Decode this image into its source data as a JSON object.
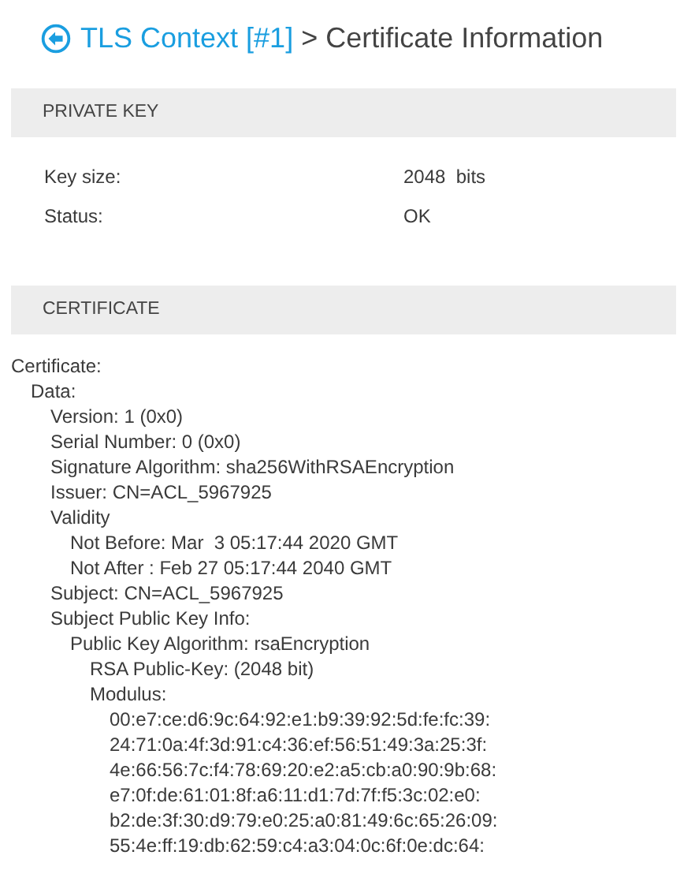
{
  "header": {
    "back_link": "TLS Context [#1]",
    "separator": ">",
    "title": "Certificate Information"
  },
  "private_key": {
    "heading": "PRIVATE KEY",
    "rows": [
      {
        "label": "Key size:",
        "value": "2048  bits"
      },
      {
        "label": "Status:",
        "value": "OK"
      }
    ]
  },
  "certificate": {
    "heading": "CERTIFICATE",
    "tree": [
      {
        "text": "Certificate:",
        "children": [
          {
            "text": "Data:",
            "children": [
              {
                "text": "Version: 1 (0x0)"
              },
              {
                "text": "Serial Number: 0 (0x0)"
              },
              {
                "text": "Signature Algorithm: sha256WithRSAEncryption"
              },
              {
                "text": "Issuer: CN=ACL_5967925"
              },
              {
                "text": "Validity",
                "children": [
                  {
                    "text": "Not Before: Mar  3 05:17:44 2020 GMT"
                  },
                  {
                    "text": "Not After : Feb 27 05:17:44 2040 GMT"
                  }
                ]
              },
              {
                "text": "Subject: CN=ACL_5967925"
              },
              {
                "text": "Subject Public Key Info:",
                "children": [
                  {
                    "text": "Public Key Algorithm: rsaEncryption",
                    "children": [
                      {
                        "text": "RSA Public-Key: (2048 bit)"
                      },
                      {
                        "text": "Modulus:",
                        "children": [
                          {
                            "text": "00:e7:ce:d6:9c:64:92:e1:b9:39:92:5d:fe:fc:39:"
                          },
                          {
                            "text": "24:71:0a:4f:3d:91:c4:36:ef:56:51:49:3a:25:3f:"
                          },
                          {
                            "text": "4e:66:56:7c:f4:78:69:20:e2:a5:cb:a0:90:9b:68:"
                          },
                          {
                            "text": "e7:0f:de:61:01:8f:a6:11:d1:7d:7f:f5:3c:02:e0:"
                          },
                          {
                            "text": "b2:de:3f:30:d9:79:e0:25:a0:81:49:6c:65:26:09:"
                          },
                          {
                            "text": "55:4e:ff:19:db:62:59:c4:a3:04:0c:6f:0e:dc:64:"
                          }
                        ]
                      }
                    ]
                  }
                ]
              }
            ]
          }
        ]
      }
    ]
  }
}
